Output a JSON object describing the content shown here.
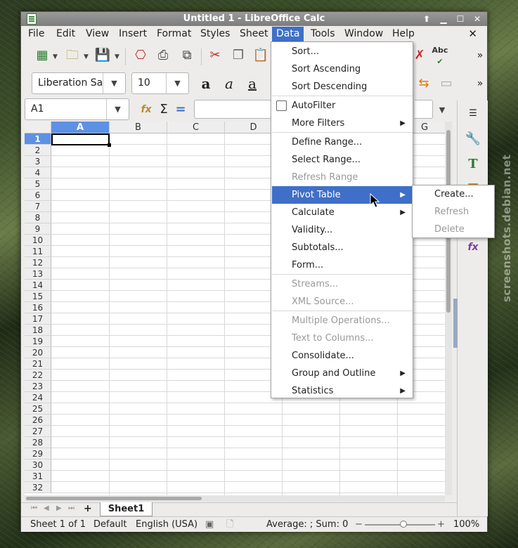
{
  "window": {
    "title": "Untitled 1 - LibreOffice Calc"
  },
  "watermark": "screenshots.debian.net",
  "menubar": {
    "items": [
      "File",
      "Edit",
      "View",
      "Insert",
      "Format",
      "Styles",
      "Sheet",
      "Data",
      "Tools",
      "Window",
      "Help"
    ],
    "active": "Data",
    "close_glyph": "✕"
  },
  "toolbar": {
    "font_name": "Liberation Sa",
    "font_size": "10",
    "spell_label": "Abc",
    "overflow_glyph": "»"
  },
  "formula_bar": {
    "name_box": "A1",
    "sum_glyph": "Σ",
    "equals_glyph": "="
  },
  "grid": {
    "columns": [
      "A",
      "B",
      "C",
      "D",
      "E",
      "F",
      "G"
    ],
    "rows": [
      "1",
      "2",
      "3",
      "4",
      "5",
      "6",
      "7",
      "8",
      "9",
      "10",
      "11",
      "12",
      "13",
      "14",
      "15",
      "16",
      "17",
      "18",
      "19",
      "20",
      "21",
      "22",
      "23",
      "24",
      "25",
      "26",
      "27",
      "28",
      "29",
      "30",
      "31",
      "32"
    ],
    "selected_cell": "A1"
  },
  "data_menu": {
    "items": [
      {
        "label": "Sort...",
        "enabled": true
      },
      {
        "label": "Sort Ascending",
        "enabled": true
      },
      {
        "label": "Sort Descending",
        "enabled": true
      },
      {
        "separator": true
      },
      {
        "label": "AutoFilter",
        "enabled": true,
        "checkbox": true
      },
      {
        "label": "More Filters",
        "enabled": true,
        "submenu": true
      },
      {
        "separator": true
      },
      {
        "label": "Define Range...",
        "enabled": true
      },
      {
        "label": "Select Range...",
        "enabled": true
      },
      {
        "label": "Refresh Range",
        "enabled": false
      },
      {
        "label": "Pivot Table",
        "enabled": true,
        "submenu": true,
        "highlighted": true
      },
      {
        "label": "Calculate",
        "enabled": true,
        "submenu": true
      },
      {
        "label": "Validity...",
        "enabled": true
      },
      {
        "label": "Subtotals...",
        "enabled": true
      },
      {
        "label": "Form...",
        "enabled": true
      },
      {
        "separator": true
      },
      {
        "label": "Streams...",
        "enabled": false
      },
      {
        "label": "XML Source...",
        "enabled": false
      },
      {
        "separator": true
      },
      {
        "label": "Multiple Operations...",
        "enabled": false
      },
      {
        "label": "Text to Columns...",
        "enabled": false
      },
      {
        "label": "Consolidate...",
        "enabled": true
      },
      {
        "label": "Group and Outline",
        "enabled": true,
        "submenu": true
      },
      {
        "label": "Statistics",
        "enabled": true,
        "submenu": true
      }
    ]
  },
  "pivot_submenu": {
    "items": [
      {
        "label": "Create...",
        "enabled": true
      },
      {
        "label": "Refresh",
        "enabled": false
      },
      {
        "label": "Delete",
        "enabled": false
      }
    ]
  },
  "sheet_tabs": {
    "tabs": [
      "Sheet1"
    ],
    "add_glyph": "+"
  },
  "statusbar": {
    "sheet": "Sheet 1 of 1",
    "page_style": "Default",
    "language": "English (USA)",
    "summary": "Average: ; Sum: 0",
    "zoom_minus": "−",
    "zoom_plus": "+",
    "zoom": "100%",
    "zoom_fraction": 0.55
  },
  "colors": {
    "accent": "#3f6fc8",
    "header_selected": "#5d91e4"
  }
}
